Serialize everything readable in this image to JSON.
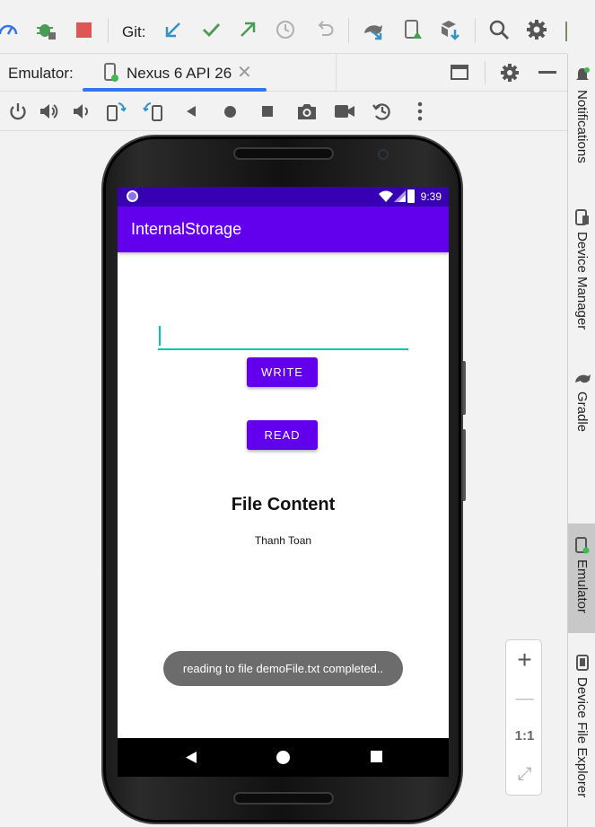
{
  "toolbar": {
    "git_label": "Git:",
    "icons": [
      "profiler-icon",
      "debug-icon",
      "stop-icon",
      "git-update-icon",
      "git-commit-icon",
      "git-push-icon",
      "history-icon",
      "rollback-icon",
      "gradle-sync-icon",
      "device-manager-icon",
      "sdk-manager-icon",
      "search-icon",
      "settings-icon",
      "avatar"
    ]
  },
  "emulator_bar": {
    "label": "Emulator:",
    "tab": "Nexus 6 API 26",
    "close": "✕"
  },
  "controls": [
    "power",
    "volume-up",
    "volume-down",
    "rotate-left",
    "rotate-right",
    "back",
    "home",
    "overview",
    "screenshot",
    "record",
    "snapshot",
    "more"
  ],
  "right_strip": {
    "items": [
      "Notifications",
      "Device Manager",
      "Gradle",
      "Emulator",
      "Device File Explorer"
    ],
    "active": "Emulator"
  },
  "device": {
    "status_time": "9:39",
    "app_title": "InternalStorage",
    "input": {
      "value": "",
      "placeholder": ""
    },
    "write_label": "WRITE",
    "read_label": "READ",
    "file_title": "File Content",
    "file_body": "Thanh Toan",
    "toast": "reading to file demoFile.txt completed.."
  },
  "zoom": {
    "plus": "+",
    "minus": "—",
    "actual": "1:1",
    "fit": "⤢"
  },
  "colors": {
    "primary": "#6200ee",
    "primary_dark": "#3700b3",
    "accent": "#03c4b4",
    "tab_underline": "#3574f0",
    "stop_red": "#e05555",
    "git_blue": "#3592c4",
    "git_green": "#499c54"
  }
}
